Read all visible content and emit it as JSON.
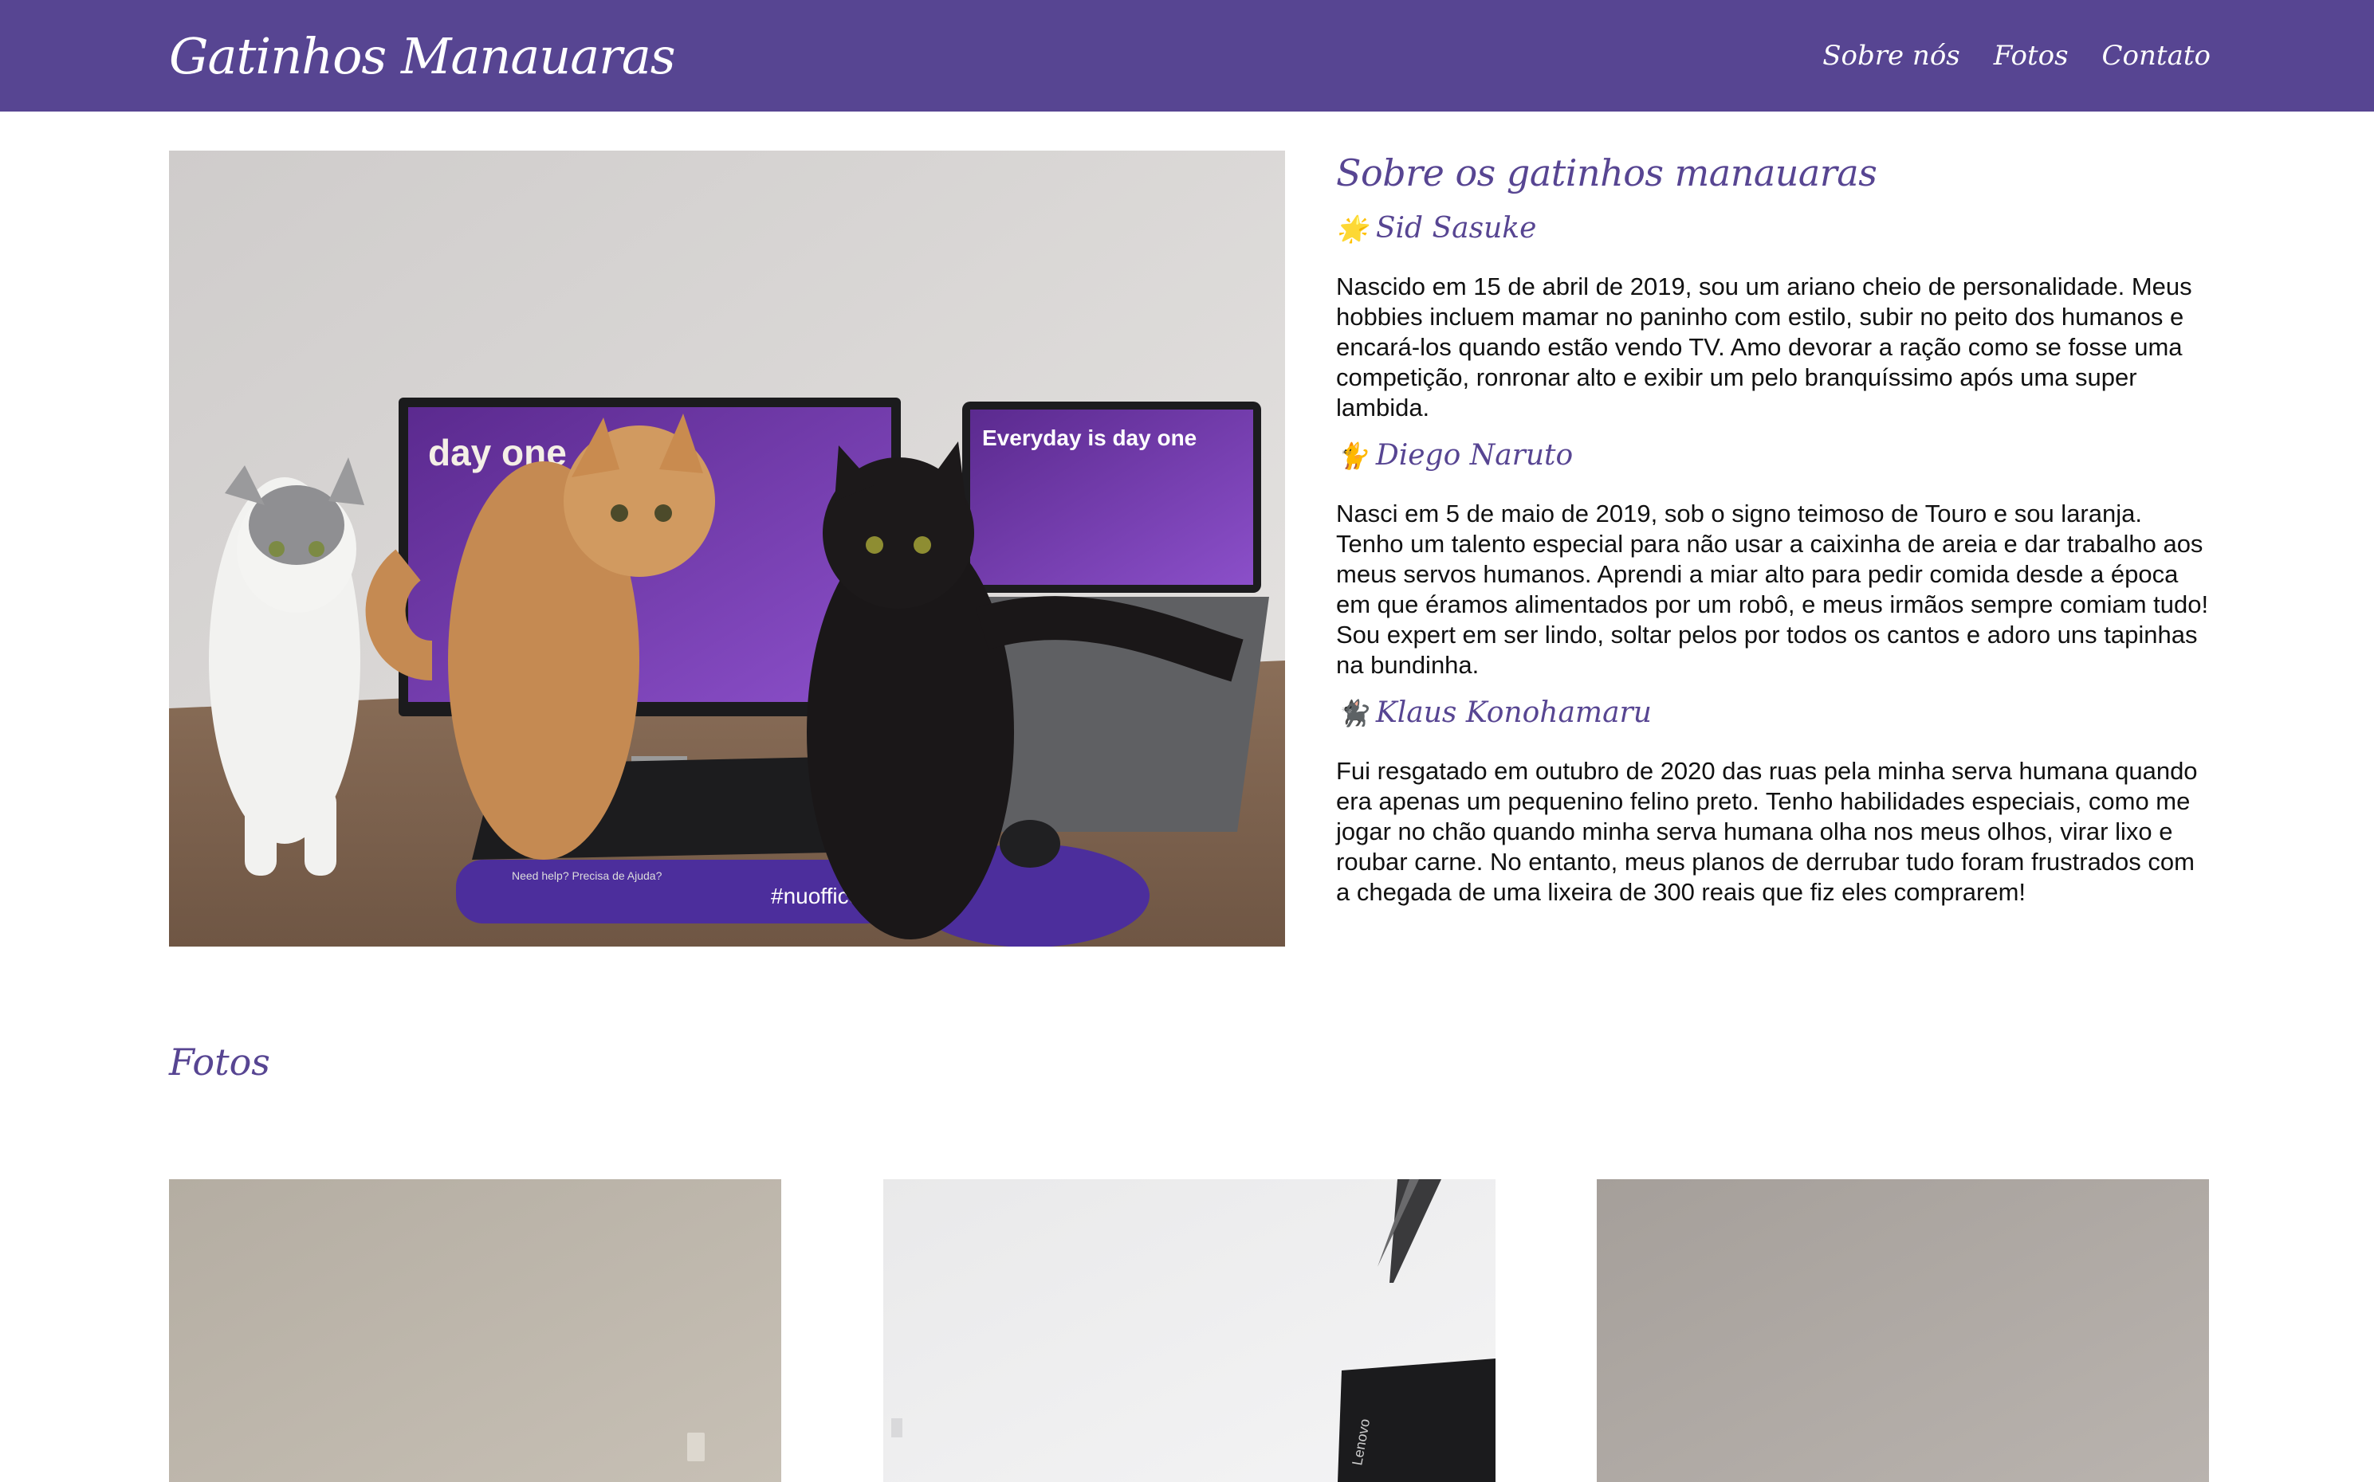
{
  "header": {
    "brand": "Gatinhos Manauaras",
    "nav": [
      "Sobre nós",
      "Fotos",
      "Contato"
    ]
  },
  "hero": {
    "screen_left_text": "day one",
    "screen_right_text": "Everyday is day one",
    "mousepad_text": "#nuoffice",
    "mousepad_small_text": "Need help? Precisa de Ajuda?"
  },
  "about": {
    "title": "Sobre os gatinhos manauaras",
    "cats": [
      {
        "emoji": "🌟",
        "name": "Sid Sasuke",
        "text": "Nascido em 15 de abril de 2019, sou um ariano cheio de personalidade. Meus hobbies incluem mamar no paninho com estilo, subir no peito dos humanos e encará-los quando estão vendo TV. Amo devorar a ração como se fosse uma competição, ronronar alto e exibir um pelo branquíssimo após uma super lambida."
      },
      {
        "emoji": "🐈",
        "name": "Diego Naruto",
        "text": "Nasci em 5 de maio de 2019, sob o signo teimoso de Touro e sou laranja. Tenho um talento especial para não usar a caixinha de areia e dar trabalho aos meus servos humanos. Aprendi a miar alto para pedir comida desde a época em que éramos alimentados por um robô, e meus irmãos sempre comiam tudo! Sou expert em ser lindo, soltar pelos por todos os cantos e adoro uns tapinhas na bundinha."
      },
      {
        "emoji": "🐈‍⬛",
        "name": "Klaus Konohamaru",
        "text": "Fui resgatado em outubro de 2020 das ruas pela minha serva humana quando era apenas um pequenino felino preto. Tenho habilidades especiais, como me jogar no chão quando minha serva humana olha nos meus olhos, virar lixo e roubar carne. No entanto, meus planos de derrubar tudo foram frustrados com a chegada de uma lixeira de 300 reais que fiz eles comprarem!"
      }
    ]
  },
  "fotos": {
    "title": "Fotos",
    "photo_text": "Lenovo"
  },
  "colors": {
    "brand": "#574592",
    "background": "#ffffff",
    "text": "#111111"
  }
}
